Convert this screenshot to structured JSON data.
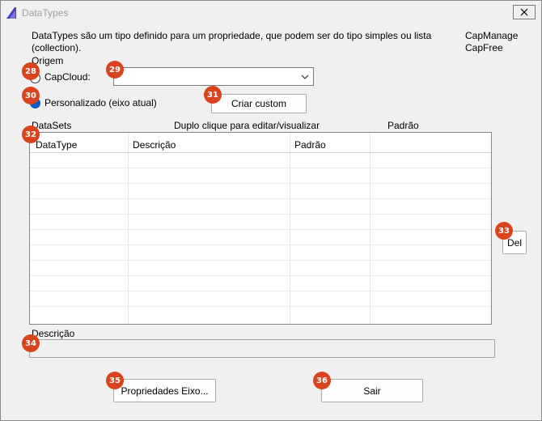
{
  "window": {
    "title": "DataTypes",
    "close_glyph": "✕"
  },
  "intro": {
    "text": "DataTypes são um tipo definido para um propriedade, que podem ser do tipo simples ou lista (collection).",
    "capmanage": "CapManage",
    "capfree": "CapFree"
  },
  "origem": {
    "label": "Origem",
    "capcloud_label": "CapCloud:",
    "capcloud_value": "",
    "personalizado_label": "Personalizado (eixo atual)",
    "personalizado_checked": true,
    "criar_custom_label": "Criar custom"
  },
  "datasets": {
    "label": "DataSets",
    "hint": "Duplo clique para editar/visualizar",
    "padrao_label": "Padrão",
    "columns": [
      "DataType",
      "Descrição",
      "Padrão",
      ""
    ],
    "rows": []
  },
  "del_label": "Del",
  "descricao": {
    "label": "Descrição",
    "value": ""
  },
  "footer": {
    "propriedades_label": "Propriedades Eixo...",
    "sair_label": "Sair"
  },
  "badges": [
    "28",
    "29",
    "30",
    "31",
    "32",
    "33",
    "34",
    "35",
    "36"
  ],
  "colors": {
    "badge": "#d9441f",
    "radio_checked": "#0a5fc4",
    "window_bg": "#f0f0f0"
  }
}
